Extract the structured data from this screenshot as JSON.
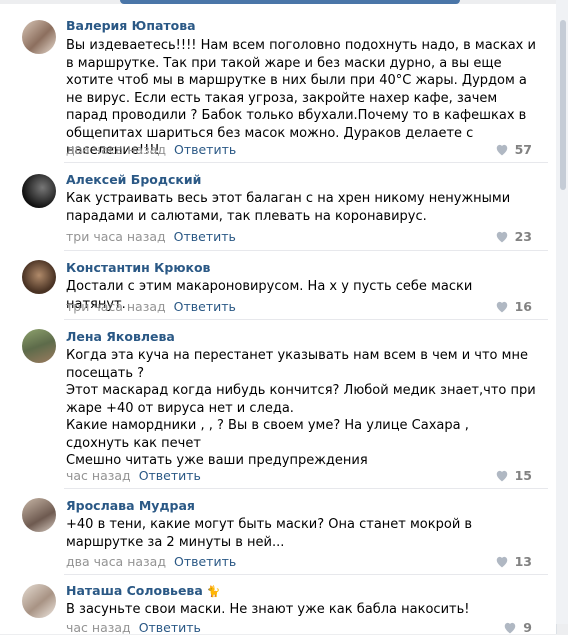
{
  "comments": [
    {
      "author": "Валерия Юпатова",
      "text": "Вы издеваетесь!!!! Нам всем поголовно подохнуть надо, в масках и в маршрутке. Так при такой жаре и без маски дурно, а вы еще хотите чтоб мы в маршрутке в них были при 40°С жары. Дурдом а не вирус. Если есть такая угроза, закройте нахер кафе, зачем парад проводили ? Бабок только вбухали.Почему то в кафешках в общепитах шариться без масок можно. Дураков делаете с население!!!!",
      "time": "два часа назад",
      "reply": "Ответить",
      "likes": "57"
    },
    {
      "author": "Алексей Бродский",
      "text": "Как устраивать весь этот балаган с на хрен никому ненужными парадами и салютами, так плевать на коронавирус.",
      "time": "три часа назад",
      "reply": "Ответить",
      "likes": "23"
    },
    {
      "author": "Константин Крюков",
      "text": "Достали с этим макароновирусом. На х  у пусть себе маски натянут.",
      "time": "три часа назад",
      "reply": "Ответить",
      "likes": "16"
    },
    {
      "author": "Лена Яковлева",
      "text": "Когда эта куча      на перестанет указывать нам всем в чем и что мне посещать ?\nЭтот маскарад когда нибудь кончится? Любой медик знает,что при жаре +40 от вируса нет и следа.\nКакие намордники ,  ,  ? Вы в своем уме? На улице Сахара , сдохнуть как печет\nСмешно читать уже ваши предупреждения",
      "time": "час назад",
      "reply": "Ответить",
      "likes": "15"
    },
    {
      "author": "Ярослава Мудрая",
      "text": "+40 в тени, какие могут быть маски? Она станет мокрой в маршрутке за 2 минуты в ней...",
      "time": "два часа назад",
      "reply": "Ответить",
      "likes": "13"
    },
    {
      "author": "Наташа Соловьева",
      "text": "В    засуньте свои маски. Не знают уже как бабла накосить!",
      "time": "час назад",
      "reply": "Ответить",
      "likes": "9"
    }
  ],
  "icons": {
    "like": "heart-icon",
    "author_badge": "cat-icon"
  },
  "colors": {
    "link": "#2a5885",
    "meta": "#939393",
    "likes": "#828282"
  }
}
